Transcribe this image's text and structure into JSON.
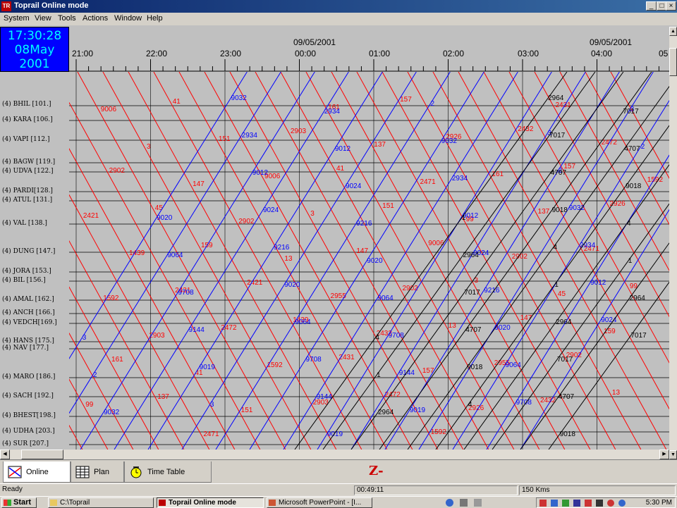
{
  "window": {
    "title": "Toprail  Online mode",
    "minimize": "_",
    "maximize": "□",
    "close": "×"
  },
  "menu": [
    "System",
    "View",
    "Tools",
    "Actions",
    "Window",
    "Help"
  ],
  "clock": {
    "time": "17:30:28",
    "date": "08May 2001"
  },
  "timeaxis": {
    "hours": [
      "21:00",
      "22:00",
      "23:00",
      "00:00",
      "01:00",
      "02:00",
      "03:00",
      "04:00",
      "05"
    ],
    "dates": [
      "09/05/2001",
      "09/05/2001"
    ]
  },
  "stations": [
    "(4) BHIL [101.]",
    "(4) KARA [106.]",
    "(4) VAPI [112.]",
    "(4) BAGW [119.]",
    "(4) UDVA [122.]",
    "(4) PARDI[128.]",
    "(4) ATUL [131.]",
    "(4) VAL [138.]",
    "(4) DUNG [147.]",
    "(4) JORA [153.]",
    "(4) BIL [156.]",
    "(4) AMAL [162.]",
    "(4) ANCH [166.]",
    "(4) VEDCH[169.]",
    "(4) HANS [175.]",
    "(4) NAV [177.]",
    "(4) MARO [186.]",
    "(4) SACH [192.]",
    "(4) BHEST[198.]",
    "(4) UDHA [203.]",
    "(4) SUR [207.]"
  ],
  "train_labels": {
    "red": [
      "147",
      "2902",
      "13",
      "2955",
      "2432",
      "157",
      "2926",
      "161",
      "137",
      "2471",
      "99",
      "2902",
      "45",
      "159",
      "2421",
      "1439",
      "2431",
      "2472",
      "1592",
      "2903",
      "41",
      "151",
      "9006",
      "3"
    ],
    "blue": [
      "9032",
      "2934",
      "9012",
      "9024",
      "9216",
      "9020",
      "9064",
      "9708",
      "9144",
      "9019",
      "3",
      "2"
    ],
    "black": [
      "2964",
      "7017",
      "4707",
      "9018",
      "4",
      "1"
    ]
  },
  "tabs": [
    {
      "label": "Online",
      "active": true
    },
    {
      "label": "Plan",
      "active": false
    },
    {
      "label": "Time Table",
      "active": false
    }
  ],
  "logo_text": "Z-",
  "status": {
    "left": "Ready",
    "elapsed": "00:49:11",
    "distance": "150  Kms"
  },
  "taskbar": {
    "start": "Start",
    "tasks": [
      "C:\\Toprail",
      "Toprail  Online mode",
      "Microsoft PowerPoint - [I..."
    ],
    "time": "5:30 PM"
  },
  "colors": {
    "up_trains": "#ff0000",
    "down_trains": "#0000ff",
    "goods_trains": "#000000",
    "clock_bg": "#0000ff",
    "clock_fg": "#00ffff"
  }
}
